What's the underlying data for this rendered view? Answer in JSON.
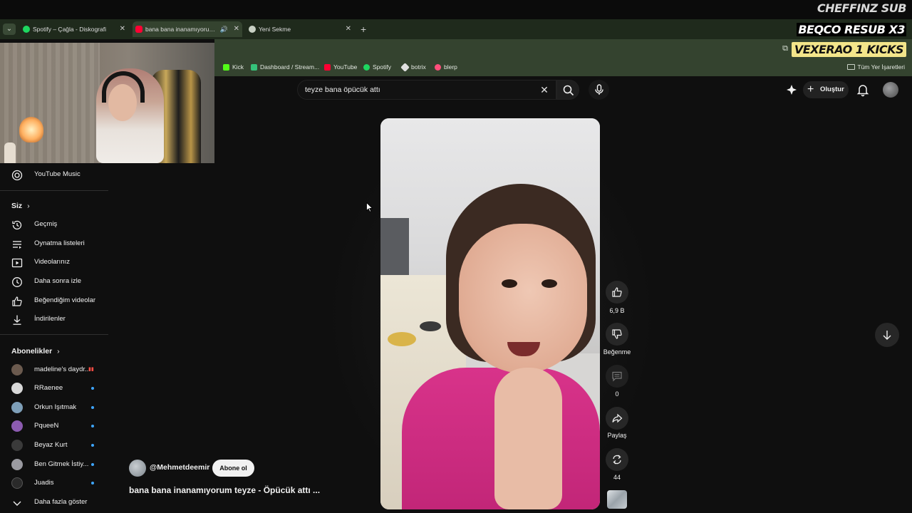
{
  "overlay": {
    "line1": "CHEFFINZ SUB",
    "line2": "BEQCO RESUB X3",
    "line3": "VEXERAO 1 KICKS"
  },
  "browser": {
    "tabs": [
      {
        "title": "Spotify – Çağla - Diskografi",
        "icon_color": "#1ed760",
        "active": false
      },
      {
        "title": "bana bana inanamıyorum te...",
        "icon_color": "#ff0033",
        "active": true
      },
      {
        "title": "Yeni Sekme",
        "icon_color": "#c8d0c4",
        "active": false
      }
    ],
    "new_tab_label": "+",
    "bookmarks": [
      {
        "label": "Kick",
        "icon_color": "#53fc18"
      },
      {
        "label": "Dashboard / Stream...",
        "icon_color": "#35c27a"
      },
      {
        "label": "YouTube",
        "icon_color": "#ff0033"
      },
      {
        "label": "Spotify",
        "icon_color": "#1ed760"
      },
      {
        "label": "botrix",
        "icon_color": "#e0e0e0"
      },
      {
        "label": "blerp",
        "icon_color": "#ff4f7b"
      }
    ],
    "all_bookmarks_label": "Tüm Yer İşaretleri"
  },
  "header": {
    "search_query": "teyze bana öpücük attı",
    "create_label": "Oluştur"
  },
  "sidebar": {
    "top_items": [
      {
        "label": "YouTube Music",
        "icon": "youtube-music-icon"
      }
    ],
    "you_heading": "Siz",
    "you_items": [
      {
        "label": "Geçmiş",
        "icon": "history-icon"
      },
      {
        "label": "Oynatma listeleri",
        "icon": "playlists-icon"
      },
      {
        "label": "Videolarınız",
        "icon": "your-videos-icon"
      },
      {
        "label": "Daha sonra izle",
        "icon": "watch-later-icon"
      },
      {
        "label": "Beğendiğim videolar",
        "icon": "liked-videos-icon"
      },
      {
        "label": "İndirilenler",
        "icon": "downloads-icon"
      }
    ],
    "subs_heading": "Abonelikler",
    "subscriptions": [
      {
        "label": "madeline's daydr...",
        "avatar_color": "#6b5a4e",
        "status": "live"
      },
      {
        "label": "RRaenee",
        "avatar_color": "#d8d8d8",
        "status": "new"
      },
      {
        "label": "Orkun Işıtmak",
        "avatar_color": "#7e9fb8",
        "status": "new"
      },
      {
        "label": "PqueeN",
        "avatar_color": "#8c5bb0",
        "status": "new"
      },
      {
        "label": "Beyaz Kurt",
        "avatar_color": "#3a3a3a",
        "status": "new"
      },
      {
        "label": "Ben Gitmek İstiy...",
        "avatar_color": "#9a9aa0",
        "status": "new"
      },
      {
        "label": "Juadis",
        "avatar_color": "#2a2a2a",
        "status": "new"
      }
    ],
    "show_more_label": "Daha fazla göster"
  },
  "short": {
    "channel": "@Mehmetdeemir",
    "subscribe_label": "Abone ol",
    "title": "bana bana inanamıyorum teyze - Öpücük attı ...",
    "likes_label": "6,9 B",
    "dislike_label": "Beğenme",
    "comments_label": "0",
    "share_label": "Paylaş",
    "remix_label": "44"
  }
}
